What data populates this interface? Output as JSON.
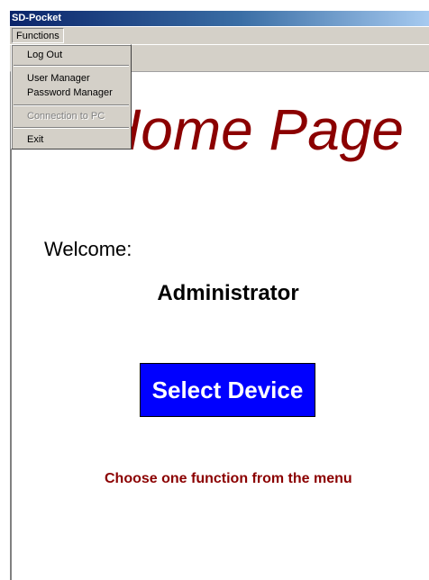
{
  "window": {
    "title": "SD-Pocket"
  },
  "menubar": {
    "functions_label": "Functions"
  },
  "menu": {
    "log_out": "Log Out",
    "user_manager": "User Manager",
    "password_manager": "Password Manager",
    "connection_to_pc": "Connection to PC",
    "exit": "Exit"
  },
  "page": {
    "title": "Home Page",
    "welcome_label": "Welcome:",
    "user_name": "Administrator",
    "select_device_label": "Select Device",
    "hint": "Choose one function from the menu"
  },
  "colors": {
    "title_red": "#8b0000",
    "button_blue": "#0000ff",
    "menu_gray": "#d4d0c8"
  }
}
